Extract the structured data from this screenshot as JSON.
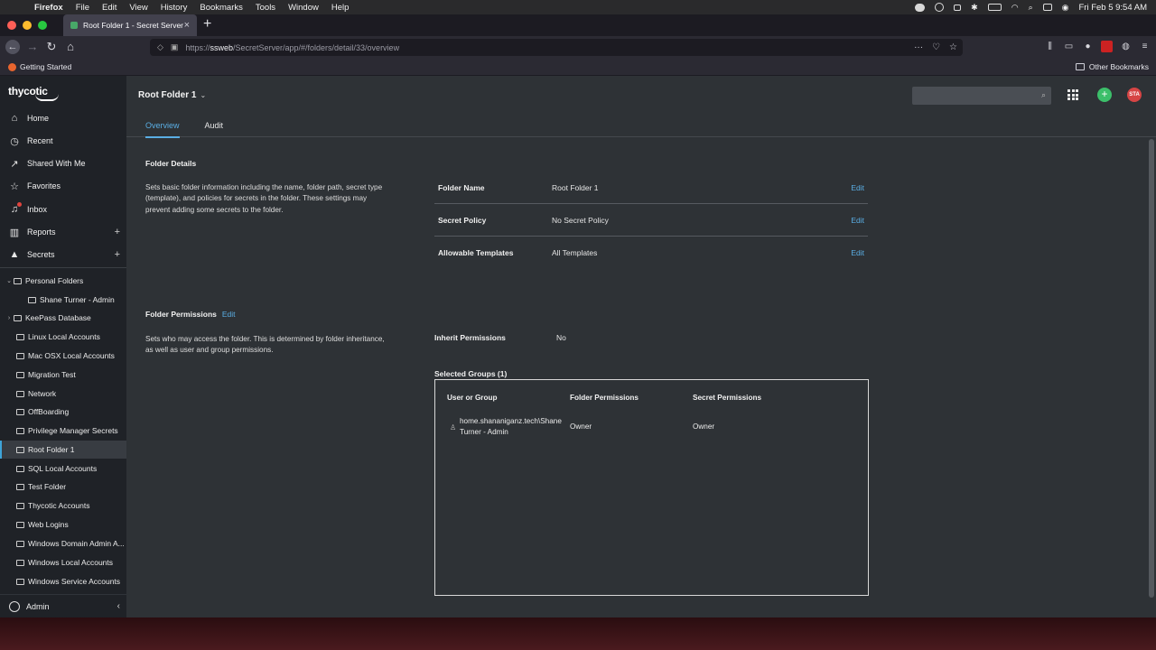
{
  "menubar": {
    "app": "Firefox",
    "items": [
      "File",
      "Edit",
      "View",
      "History",
      "Bookmarks",
      "Tools",
      "Window",
      "Help"
    ],
    "clock": "Fri Feb 5  9:54 AM"
  },
  "browser": {
    "tab_title": "Root Folder 1 - Secret Server",
    "url_prefix": "https://",
    "url_host": "ssweb",
    "url_path": "/SecretServer/app/#/folders/detail/33/overview",
    "bookmark_left": "Getting Started",
    "bookmark_right": "Other Bookmarks"
  },
  "sidebar": {
    "logo": "thycotic",
    "nav": [
      {
        "label": "Home",
        "icon": "home-icon"
      },
      {
        "label": "Recent",
        "icon": "clock-icon"
      },
      {
        "label": "Shared With Me",
        "icon": "share-icon"
      },
      {
        "label": "Favorites",
        "icon": "star-icon"
      },
      {
        "label": "Inbox",
        "icon": "bell-icon"
      },
      {
        "label": "Reports",
        "icon": "bar-chart-icon"
      },
      {
        "label": "Secrets",
        "icon": "lock-icon"
      }
    ],
    "folders": [
      {
        "label": "Personal Folders",
        "chevron": "⌄"
      },
      {
        "label": "Shane Turner - Admin",
        "chevron": ""
      },
      {
        "label": "KeePass Database",
        "chevron": "›"
      },
      {
        "label": "Linux Local Accounts",
        "chevron": ""
      },
      {
        "label": "Mac OSX Local Accounts",
        "chevron": ""
      },
      {
        "label": "Migration Test",
        "chevron": ""
      },
      {
        "label": "Network",
        "chevron": ""
      },
      {
        "label": "OffBoarding",
        "chevron": ""
      },
      {
        "label": "Privilege Manager Secrets",
        "chevron": ""
      },
      {
        "label": "Root Folder 1",
        "chevron": ""
      },
      {
        "label": "SQL Local Accounts",
        "chevron": ""
      },
      {
        "label": "Test Folder",
        "chevron": ""
      },
      {
        "label": "Thycotic Accounts",
        "chevron": ""
      },
      {
        "label": "Web Logins",
        "chevron": ""
      },
      {
        "label": "Windows Domain Admin A...",
        "chevron": ""
      },
      {
        "label": "Windows Local Accounts",
        "chevron": ""
      },
      {
        "label": "Windows Service Accounts",
        "chevron": ""
      }
    ],
    "footer_user": "Admin"
  },
  "header": {
    "title": "Root Folder 1",
    "tabs": [
      "Overview",
      "Audit"
    ],
    "user_initials": "STA",
    "add_symbol": "+"
  },
  "details": {
    "title": "Folder Details",
    "description": "Sets basic folder information including the name, folder path, secret type (template), and policies for secrets in the folder. These settings may prevent adding some secrets to the folder.",
    "rows": [
      {
        "label": "Folder Name",
        "value": "Root Folder 1",
        "action": "Edit"
      },
      {
        "label": "Secret Policy",
        "value": "No Secret Policy",
        "action": "Edit"
      },
      {
        "label": "Allowable Templates",
        "value": "All Templates",
        "action": "Edit"
      }
    ]
  },
  "permissions": {
    "title": "Folder Permissions",
    "edit": "Edit",
    "description": "Sets who may access the folder. This is determined by folder inheritance, as well as user and group permissions.",
    "inherit_label": "Inherit Permissions",
    "inherit_value": "No",
    "selected_groups": "Selected Groups (1)",
    "columns": [
      "User or Group",
      "Folder Permissions",
      "Secret Permissions"
    ],
    "rows": [
      {
        "user": "home.shananiganz.tech\\Shane Turner - Admin",
        "folder": "Owner",
        "secret": "Owner"
      }
    ]
  }
}
